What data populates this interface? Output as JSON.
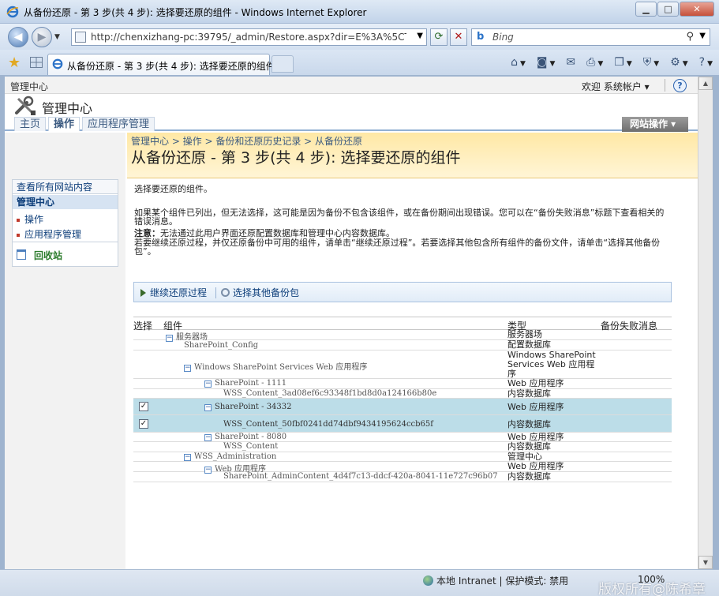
{
  "window": {
    "title": "从备份还原 - 第 3 步(共 4 步): 选择要还原的组件 - Windows Internet Explorer",
    "minimize": "▁",
    "maximize": "□",
    "close": "✕"
  },
  "address": {
    "url": "http://chenxizhang-pc:39795/_admin/Restore.aspx?dir=E%3A%5CTemp%5Cb",
    "search_placeholder": "Bing"
  },
  "tab": {
    "label": "从备份还原 - 第 3 步(共 4 步): 选择要还原的组件"
  },
  "sp": {
    "site_crumb": "管理中心",
    "welcome": "欢迎  系统帐户 ▾",
    "site_title": "管理中心",
    "nav": {
      "home": "主页",
      "operations": "操作",
      "app_management": "应用程序管理"
    },
    "site_actions": "网站操作 ▾"
  },
  "quicklaunch": {
    "view_all": "查看所有网站内容",
    "heading": "管理中心",
    "items": [
      "操作",
      "应用程序管理"
    ],
    "recycle_bin": "回收站"
  },
  "page": {
    "crumbs": "管理中心  >  操作  >  备份和还原历史记录  >  从备份还原",
    "heading": "从备份还原 - 第 3 步(共 4 步): 选择要还原的组件",
    "p1": "选择要还原的组件。",
    "p2": "如果某个组件已列出，但无法选择，这可能是因为备份不包含该组件，或在备份期间出现错误。您可以在“备份失败消息”标题下查看相关的错误消息。",
    "p3_label": "注意：",
    "p3_text": "无法通过此用户界面还原配置数据库和管理中心内容数据库。",
    "p4": "若要继续还原过程，并仅还原备份中可用的组件，请单击“继续还原过程”。若要选择其他包含所有组件的备份文件，请单击“选择其他备份包”。"
  },
  "toolbar": {
    "continue": "继续还原过程",
    "select_other": "选择其他备份包"
  },
  "grid": {
    "headers": {
      "select": "选择",
      "component": "组件",
      "type": "类型",
      "failure": "备份失败消息"
    },
    "rows": [
      {
        "name": "服务器场",
        "type": "服务器场",
        "toggle": "−"
      },
      {
        "name": "SharePoint_Config",
        "type": "配置数据库"
      },
      {
        "name": "Windows SharePoint Services Web 应用程序",
        "type": "Windows SharePoint Services Web 应用程序",
        "toggle": "−"
      },
      {
        "name": "SharePoint - 1111",
        "type": "Web 应用程序",
        "toggle": "−"
      },
      {
        "name": "WSS_Content_3ad08ef6c93348f1bd8d0a124166b80e",
        "type": "内容数据库"
      },
      {
        "name": "SharePoint - 34332",
        "type": "Web 应用程序",
        "toggle": "−",
        "check": "✓"
      },
      {
        "name": "WSS_Content_50fbf0241dd74dbf9434195624ccb65f",
        "type": "内容数据库",
        "check": "✓"
      },
      {
        "name": "SharePoint - 8080",
        "type": "Web 应用程序",
        "toggle": "−"
      },
      {
        "name": "WSS_Content",
        "type": "内容数据库"
      },
      {
        "name": "WSS_Administration",
        "type": "管理中心",
        "toggle": "−"
      },
      {
        "name": "Web 应用程序",
        "type": "Web 应用程序",
        "toggle": "−"
      },
      {
        "name": "SharePoint_AdminContent_4d4f7c13-ddcf-420a-8041-11e727c96b07",
        "type": "内容数据库"
      }
    ]
  },
  "status": {
    "zone": "本地 Intranet | 保护模式: 禁用",
    "zoom": "100%",
    "watermark": "版权所有@陈希章"
  },
  "colors": {
    "selected_row": "#bcdde8",
    "title_area": "#ffe8a5",
    "link": "#0d3e7a"
  }
}
